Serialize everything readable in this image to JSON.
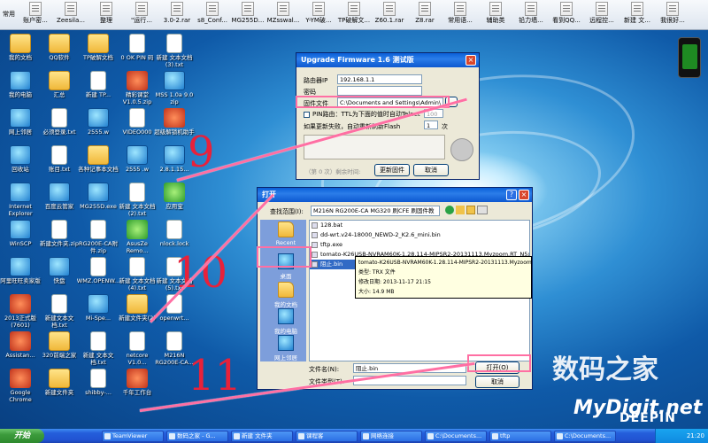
{
  "topbar": {
    "items": [
      "常用",
      "账户密...",
      "Zeesila...",
      "整理",
      "\"运行...",
      "3.0-2.rar",
      "s8_Conf...",
      "MG255D...",
      "MZsswal...",
      "Y-YM破...",
      "TP破解文...",
      "Z60.1.rar",
      "Z8.rar",
      "常用语...",
      "辅助类",
      "铅力墙...",
      "看到QQ...",
      "远程控...",
      "新建 文...",
      "我很好..."
    ]
  },
  "desktop_icons": [
    {
      "label": "我的文档",
      "type": "folder"
    },
    {
      "label": "QQ软件",
      "type": "folder"
    },
    {
      "label": "TP破解文档",
      "type": "folder"
    },
    {
      "label": "0 OK PIN 码",
      "type": "file"
    },
    {
      "label": "新建 文本文档 (3).txt",
      "type": "file"
    },
    {
      "label": "我的电脑",
      "type": "app"
    },
    {
      "label": "汇总",
      "type": "folder"
    },
    {
      "label": "新建 TP...",
      "type": "file"
    },
    {
      "label": "精彩课堂 V1.0.5.zip",
      "type": "red"
    },
    {
      "label": "MSS 1.0a 9.0 zip",
      "type": "app"
    },
    {
      "label": "网上邻居",
      "type": "app"
    },
    {
      "label": "必须登录.txt",
      "type": "file"
    },
    {
      "label": "2555.w",
      "type": "app"
    },
    {
      "label": "VIDEO000",
      "type": "file"
    },
    {
      "label": "超级解锁机助手",
      "type": "red"
    },
    {
      "label": "回收站",
      "type": "app"
    },
    {
      "label": "账目.txt",
      "type": "file"
    },
    {
      "label": "各种记事本文档",
      "type": "folder"
    },
    {
      "label": "2555 .w",
      "type": "app"
    },
    {
      "label": "2.8.1.15...",
      "type": "app"
    },
    {
      "label": "Internet Explorer",
      "type": "app"
    },
    {
      "label": "百度云管家",
      "type": "app"
    },
    {
      "label": "MG255D.exe",
      "type": "app"
    },
    {
      "label": "新建 文本文档 (2).txt",
      "type": "file"
    },
    {
      "label": "应用宝",
      "type": "green"
    },
    {
      "label": "WinSCP",
      "type": "app"
    },
    {
      "label": "新建文件夹.zip",
      "type": "file"
    },
    {
      "label": "RG200E-CA附件.zip",
      "type": "file"
    },
    {
      "label": "AsusZe Remo...",
      "type": "green"
    },
    {
      "label": "nlock.lock",
      "type": "file"
    },
    {
      "label": "阿里旺旺卖家版",
      "type": "app"
    },
    {
      "label": "快盘",
      "type": "app"
    },
    {
      "label": "WMZ.OPENW...",
      "type": "file"
    },
    {
      "label": "新建 文本文档 (4).txt",
      "type": "file"
    },
    {
      "label": "新建 文本文档 (5).txt",
      "type": "file"
    },
    {
      "label": "2013正式版(7601)",
      "type": "red"
    },
    {
      "label": "新建文本文档.txt",
      "type": "file"
    },
    {
      "label": "Mi-Spe...",
      "type": "app"
    },
    {
      "label": "新建文件夹(2)",
      "type": "folder"
    },
    {
      "label": "openwrt...",
      "type": "file"
    },
    {
      "label": "Assistan...",
      "type": "red"
    },
    {
      "label": "320前端之家",
      "type": "folder"
    },
    {
      "label": "新建 文本文档.txt",
      "type": "file"
    },
    {
      "label": "netcore V1.0...",
      "type": "file"
    },
    {
      "label": "M216N RG200E-CA...",
      "type": "file"
    },
    {
      "label": "Google Chrome",
      "type": "red"
    },
    {
      "label": "新建文件夹",
      "type": "folder"
    },
    {
      "label": "shibby-...",
      "type": "file"
    },
    {
      "label": "千年工作台",
      "type": "red"
    }
  ],
  "annotations": {
    "n9": "9",
    "n10": "10",
    "n11": "11"
  },
  "upgrade_window": {
    "title": "Upgrade Firmware 1.6 测试版",
    "router_ip_label": "路由器IP",
    "router_ip": "192.168.1.1",
    "password_label": "密码",
    "password": "",
    "firmware_label": "固件文件",
    "firmware_path": "C:\\Documents and Settings\\Admin\\",
    "pin_label": "PIN路由：TTL为下面的值时自动Telnet",
    "pin_value": "100",
    "retry_label": "如果更新失败，自动重新刷新Flash",
    "retry_value": "1",
    "retry_unit": "次",
    "progress_text": "（第 0 次）剩余时间:",
    "update_button": "更新固件",
    "cancel_button": "取消"
  },
  "open_dialog": {
    "title": "打开",
    "lookin_label": "查找范围(I):",
    "lookin_value": "M216N RG200E-CA MG320 刷CFE 刷固件教",
    "places": [
      "Recent",
      "桌面",
      "我的文档",
      "我的电脑",
      "网上邻居"
    ],
    "files": [
      "128.bat",
      "dd-wrt.v24-18000_NEWD-2_K2.6_mini.bin",
      "tftp.exe",
      "tomato-K26USB-NVRAM60K-1.28.114-MIPSR2-20131113.Myzoom.RT_N5x-16M-NV60K...",
      "阻止.bin"
    ],
    "tooltip": [
      "tomato-K26USB-NVRAM60K-1.28.114-MIPSR2-20131113.Myzoom.RT_N5x-16M-NV60K-Ext-AIO-AR-TR-FT-OAE.trx",
      "类型: TRX 文件",
      "修改日期: 2013-11-17 21:15",
      "大小: 14.9 MB"
    ],
    "filename_label": "文件名(N):",
    "filename_value": "阻止.bin",
    "filetype_label": "文件类型(T):",
    "filetype_value": "",
    "open_button": "打开(O)",
    "cancel_button": "取消"
  },
  "watermark": {
    "site_cn": "数码之家",
    "site_en": "MyDigit.net",
    "deepin": "DEEPIN"
  },
  "taskbar": {
    "start": "开始",
    "tasks": [
      "TeamViewer",
      "数码之家 - G...",
      "新建 文件夹",
      "课程客",
      "网络连接",
      "C:\\Documents...",
      "tftp",
      "C:\\Documents..."
    ],
    "clock": "21:20"
  }
}
